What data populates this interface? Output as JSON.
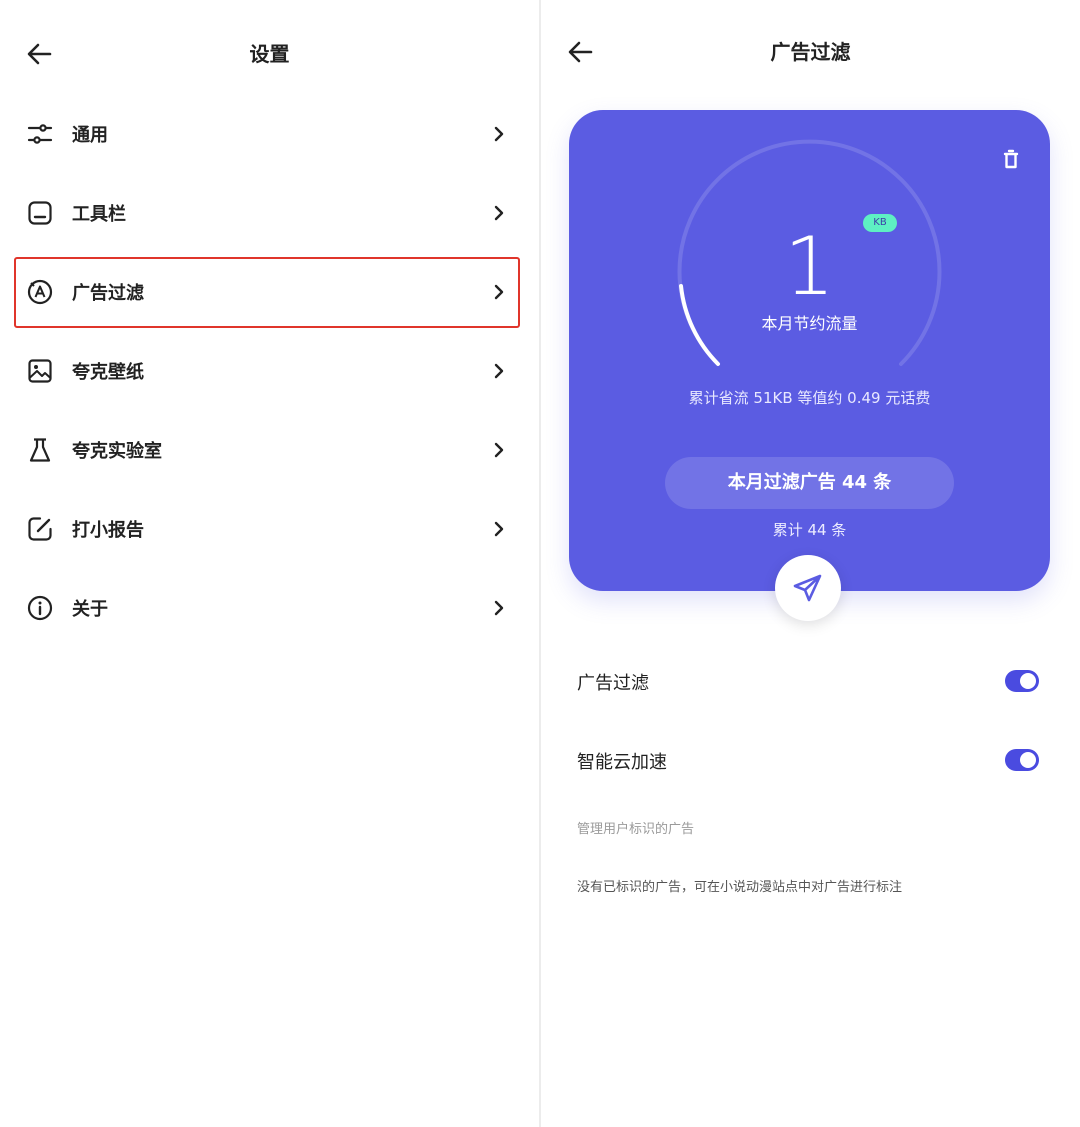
{
  "left_panel": {
    "title": "设置",
    "menu": [
      {
        "label": "通用",
        "icon": "sliders-icon"
      },
      {
        "label": "工具栏",
        "icon": "toolbar-icon"
      },
      {
        "label": "广告过滤",
        "icon": "ad-filter-icon",
        "highlighted": true
      },
      {
        "label": "夸克壁纸",
        "icon": "wallpaper-icon"
      },
      {
        "label": "夸克实验室",
        "icon": "flask-icon"
      },
      {
        "label": "打小报告",
        "icon": "feedback-edit-icon"
      },
      {
        "label": "关于",
        "icon": "info-icon"
      }
    ]
  },
  "right_panel": {
    "title": "广告过滤",
    "card": {
      "unit_badge": "KB",
      "saved_value": "1",
      "saved_caption": "本月节约流量",
      "cumulative_text": "累计省流 51KB 等值约 0.49 元话费",
      "filtered_pill": "本月过滤广告 44 条",
      "filtered_total": "累计 44 条",
      "accent_color": "#5b5ce2"
    },
    "settings": [
      {
        "label": "广告过滤",
        "enabled": true
      },
      {
        "label": "智能云加速",
        "enabled": true
      }
    ],
    "section_title": "管理用户标识的广告",
    "empty_note": "没有已标识的广告，可在小说动漫站点中对广告进行标注"
  }
}
